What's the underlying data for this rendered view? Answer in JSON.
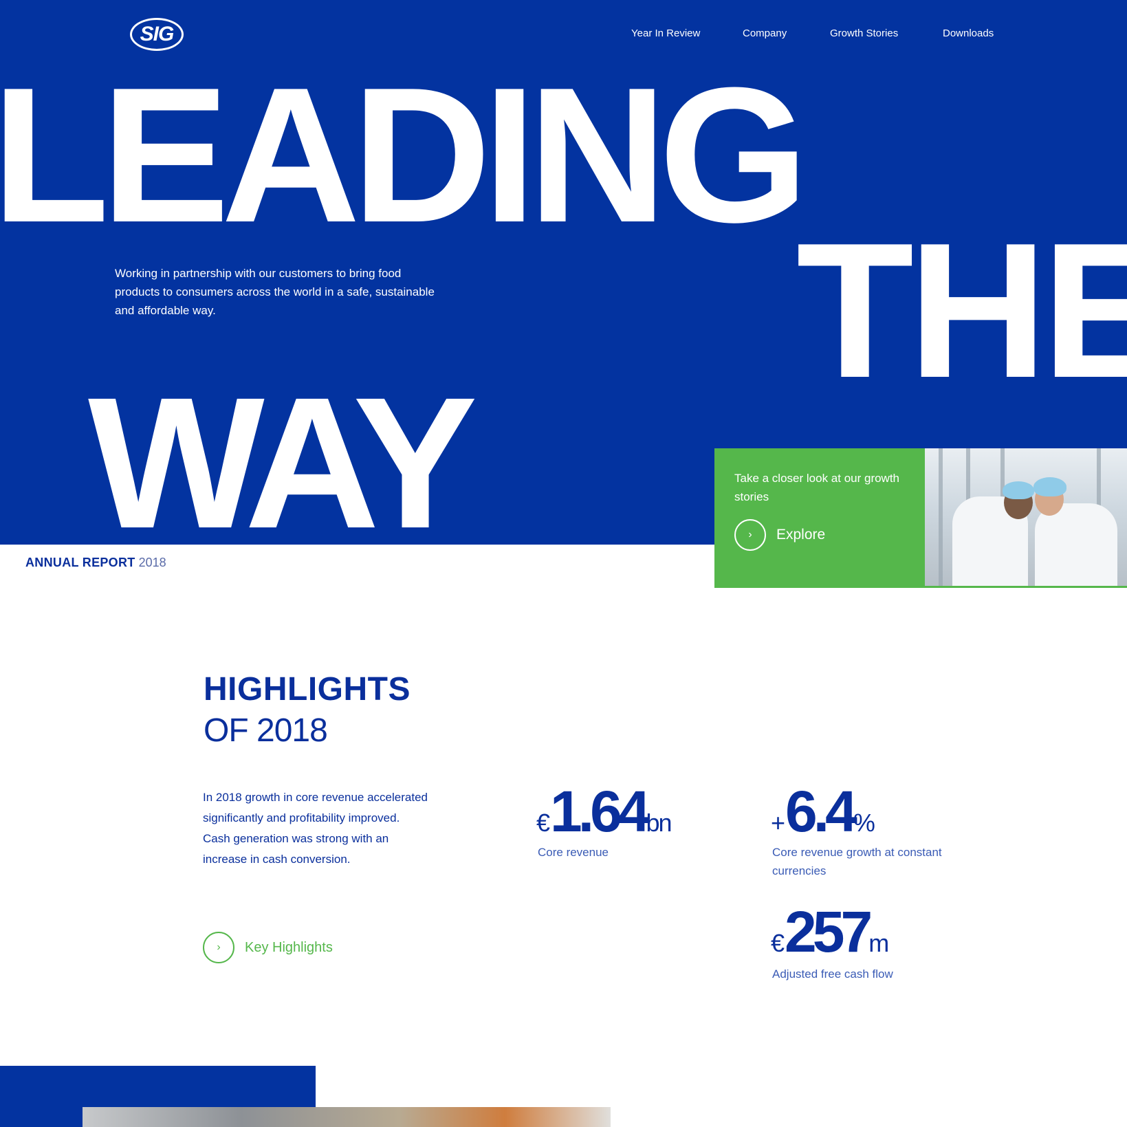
{
  "brand": {
    "logo_text": "SIG",
    "primary_color": "#0333a0",
    "accent_color": "#55b74b"
  },
  "nav": {
    "items": [
      "Year In Review",
      "Company",
      "Growth Stories",
      "Downloads"
    ]
  },
  "hero": {
    "word1": "LEADING",
    "word2": "THE",
    "word3": "WAY",
    "description": "Working in partnership with our customers to bring food products to consumers across the world in a safe, sustainable and affordable way."
  },
  "report": {
    "label": "ANNUAL REPORT",
    "year": "2018"
  },
  "promo": {
    "text": "Take a closer look at our growth stories",
    "button_label": "Explore",
    "button_icon": "chevron-right-icon"
  },
  "highlights": {
    "title": "HIGHLIGHTS",
    "subtitle": "OF 2018",
    "description": "In 2018 growth in core revenue accelerated significantly and profitability improved. Cash generation was strong with an increase in cash conversion.",
    "link_label": "Key Highlights",
    "stats": [
      {
        "prefix": "€",
        "value": "1.64",
        "unit": "bn",
        "label": "Core revenue"
      },
      {
        "prefix": "+",
        "value": "6.4",
        "unit": "%",
        "label": "Core revenue growth at constant currencies"
      },
      {
        "prefix": "€",
        "value": "257",
        "unit": "m",
        "label": "Adjusted free cash flow"
      }
    ]
  }
}
